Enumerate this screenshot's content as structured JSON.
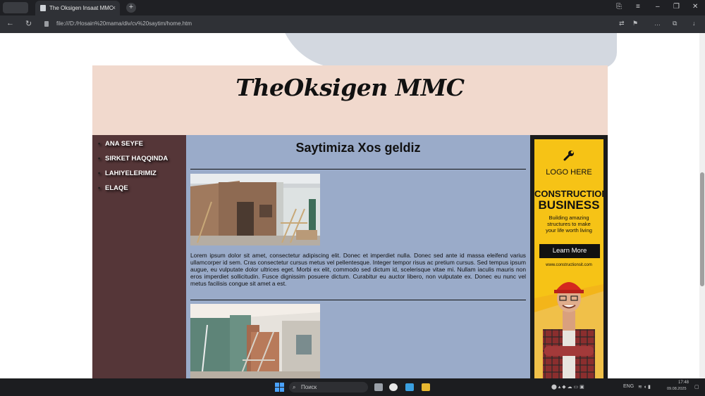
{
  "browser": {
    "tab_title": "The Oksigen Insaat MMC",
    "tab_close": "×",
    "new_tab": "+",
    "url": "file:///D:/Hosain%20mama/div/cv%20saytim/home.htm",
    "window_controls": [
      "⎘",
      "≡",
      "–",
      "❐",
      "✕"
    ],
    "toolbar_icons": [
      "⇄",
      "⚑",
      "…",
      "⧉",
      "↓"
    ]
  },
  "site": {
    "title": "TheOksigen MMC",
    "nav": [
      "ANA SEYFE",
      "SIRKET HAQQINDA",
      "LAHIYELERIMIZ",
      "ELAQE"
    ],
    "heading": "Saytimiza Xos geldiz",
    "lorem": "Lorem ipsum dolor sit amet, consectetur adipiscing elit. Donec et imperdiet nulla. Donec sed ante id massa eleifend varius ullamcorper id sem. Cras consectetur cursus metus vel pellentesque. Integer tempor risus ac pretium cursus. Sed tempus ipsum augue, eu vulputate dolor ultrices eget. Morbi ex elit, commodo sed dictum id, scelerisque vitae mi. Nullam iaculis mauris non eros imperdiet sollicitudin. Fusce dignissim posuere dictum. Curabitur eu auctor libero, non vulputate ex. Donec eu nunc vel metus facilisis congue sit amet a est."
  },
  "ad": {
    "logo_text": "LOGO HERE",
    "headline1": "CONSTRUCTION",
    "headline2": "BUSINESS",
    "subtext": "Building amazing structures to make your life worth living",
    "button": "Learn More",
    "url": "www.constructionsit.com"
  },
  "taskbar": {
    "search_placeholder": "Поиск",
    "lang": "ENG",
    "time": "17:48",
    "date": "09.08.2025"
  },
  "colors": {
    "header_bg": "#f1d9cd",
    "sidebar_bg": "#553638",
    "main_bg": "#9aabc9",
    "ad_yellow": "#f6c316"
  }
}
